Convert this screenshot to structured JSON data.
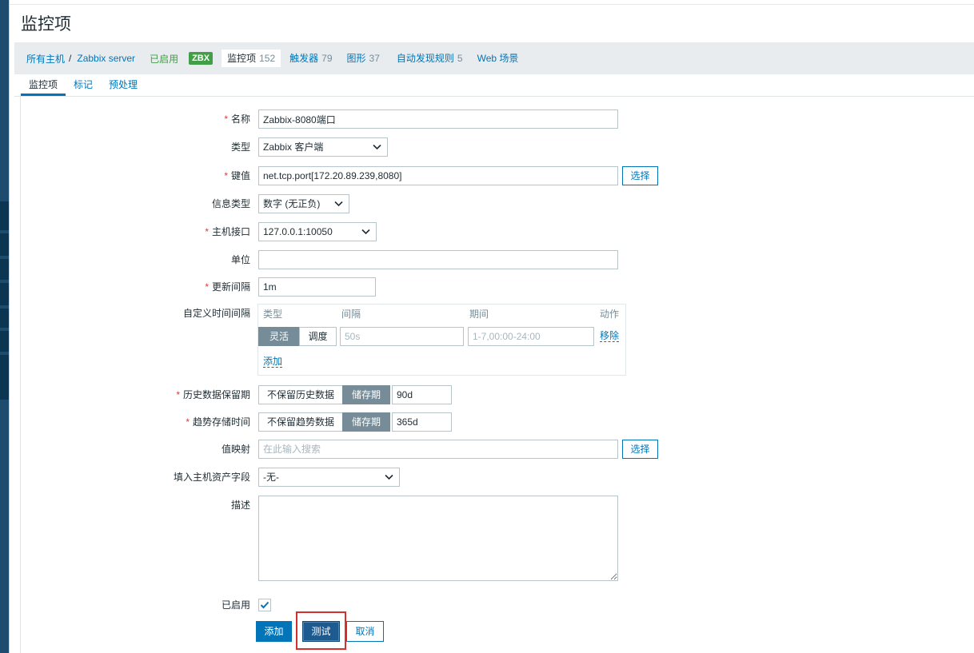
{
  "page": {
    "title": "监控项"
  },
  "breadcrumb": {
    "all_hosts": "所有主机",
    "separator": "/",
    "host": "Zabbix server",
    "status": "已启用",
    "badge": "ZBX",
    "tabs": [
      {
        "label": "监控项",
        "count": "152",
        "selected": true
      },
      {
        "label": "触发器",
        "count": "79"
      },
      {
        "label": "图形",
        "count": "37"
      },
      {
        "label": "自动发现规则",
        "count": "5"
      },
      {
        "label": "Web 场景"
      }
    ]
  },
  "form_tabs": [
    {
      "label": "监控项",
      "selected": true
    },
    {
      "label": "标记"
    },
    {
      "label": "预处理"
    }
  ],
  "required_mark": "*",
  "form": {
    "name": {
      "label": "名称",
      "required": true,
      "value": "Zabbix-8080端口"
    },
    "type": {
      "label": "类型",
      "value": "Zabbix 客户端"
    },
    "key": {
      "label": "键值",
      "required": true,
      "value": "net.tcp.port[172.20.89.239,8080]",
      "button": "选择"
    },
    "value_type": {
      "label": "信息类型",
      "value": "数字 (无正负)"
    },
    "interface": {
      "label": "主机接口",
      "required": true,
      "value": "127.0.0.1:10050"
    },
    "units": {
      "label": "单位"
    },
    "delay": {
      "label": "更新间隔",
      "required": true,
      "value": "1m"
    },
    "custom_intervals": {
      "label": "自定义时间间隔",
      "columns": [
        "类型",
        "间隔",
        "期间",
        "动作"
      ],
      "rows": [
        {
          "options": [
            {
              "label": "灵活",
              "selected": true
            },
            {
              "label": "调度"
            }
          ],
          "interval_placeholder": "50s",
          "period_placeholder": "1-7,00:00-24:00",
          "remove": "移除"
        }
      ],
      "add": "添加"
    },
    "history": {
      "label": "历史数据保留期",
      "required": true,
      "options": [
        {
          "label": "不保留历史数据"
        },
        {
          "label": "储存期",
          "selected": true
        }
      ],
      "value": "90d"
    },
    "trends": {
      "label": "趋势存储时间",
      "required": true,
      "options": [
        {
          "label": "不保留趋势数据"
        },
        {
          "label": "储存期",
          "selected": true
        }
      ],
      "value": "365d"
    },
    "valuemap": {
      "label": "值映射",
      "placeholder": "在此输入搜索",
      "button": "选择"
    },
    "inventory": {
      "label": "填入主机资产字段",
      "value": "-无-"
    },
    "description": {
      "label": "描述"
    },
    "enabled": {
      "label": "已启用",
      "checked": true
    }
  },
  "buttons": {
    "add": "添加",
    "test": "测试",
    "cancel": "取消"
  },
  "icons": {
    "select_arrow": "chevron-down-icon",
    "checkbox_mark": "check-icon"
  },
  "colors": {
    "accent": "#0275b8",
    "required": "#e33734",
    "status_green": "#429e47",
    "segment_selected": "#768d99",
    "highlight": "#d3302f",
    "sidebar": "#1d4c6e",
    "sidebar_dark": "#0c3552",
    "focused_button": "#1c5a8f"
  }
}
